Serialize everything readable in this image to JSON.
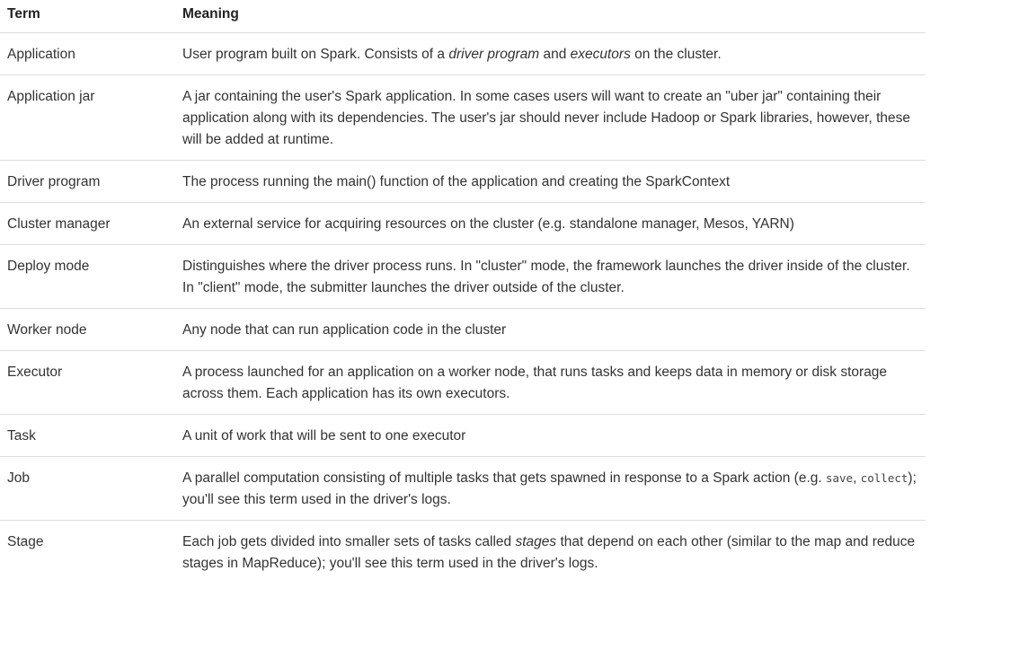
{
  "table": {
    "headers": {
      "term": "Term",
      "meaning": "Meaning"
    },
    "rows": [
      {
        "term": "Application",
        "meaning": [
          {
            "t": "User program built on Spark. Consists of a "
          },
          {
            "t": "driver program",
            "em": true
          },
          {
            "t": " and "
          },
          {
            "t": "executors",
            "em": true
          },
          {
            "t": " on the cluster."
          }
        ]
      },
      {
        "term": "Application jar",
        "meaning": [
          {
            "t": "A jar containing the user's Spark application. In some cases users will want to create an \"uber jar\" containing their application along with its dependencies. The user's jar should never include Hadoop or Spark libraries, however, these will be added at runtime."
          }
        ]
      },
      {
        "term": "Driver program",
        "meaning": [
          {
            "t": "The process running the main() function of the application and creating the SparkContext"
          }
        ]
      },
      {
        "term": "Cluster manager",
        "meaning": [
          {
            "t": "An external service for acquiring resources on the cluster (e.g. standalone manager, Mesos, YARN)"
          }
        ]
      },
      {
        "term": "Deploy mode",
        "meaning": [
          {
            "t": "Distinguishes where the driver process runs. In \"cluster\" mode, the framework launches the driver inside of the cluster. In \"client\" mode, the submitter launches the driver outside of the cluster."
          }
        ]
      },
      {
        "term": "Worker node",
        "meaning": [
          {
            "t": "Any node that can run application code in the cluster"
          }
        ]
      },
      {
        "term": "Executor",
        "meaning": [
          {
            "t": "A process launched for an application on a worker node, that runs tasks and keeps data in memory or disk storage across them. Each application has its own executors."
          }
        ]
      },
      {
        "term": "Task",
        "meaning": [
          {
            "t": "A unit of work that will be sent to one executor"
          }
        ]
      },
      {
        "term": "Job",
        "meaning": [
          {
            "t": "A parallel computation consisting of multiple tasks that gets spawned in response to a Spark action (e.g. "
          },
          {
            "t": "save",
            "code": true
          },
          {
            "t": ", "
          },
          {
            "t": "collect",
            "code": true
          },
          {
            "t": "); you'll see this term used in the driver's logs."
          }
        ]
      },
      {
        "term": "Stage",
        "meaning": [
          {
            "t": "Each job gets divided into smaller sets of tasks called "
          },
          {
            "t": "stages",
            "em": true
          },
          {
            "t": " that depend on each other (similar to the map and reduce stages in MapReduce); you'll see this term used in the driver's logs."
          }
        ]
      }
    ]
  }
}
